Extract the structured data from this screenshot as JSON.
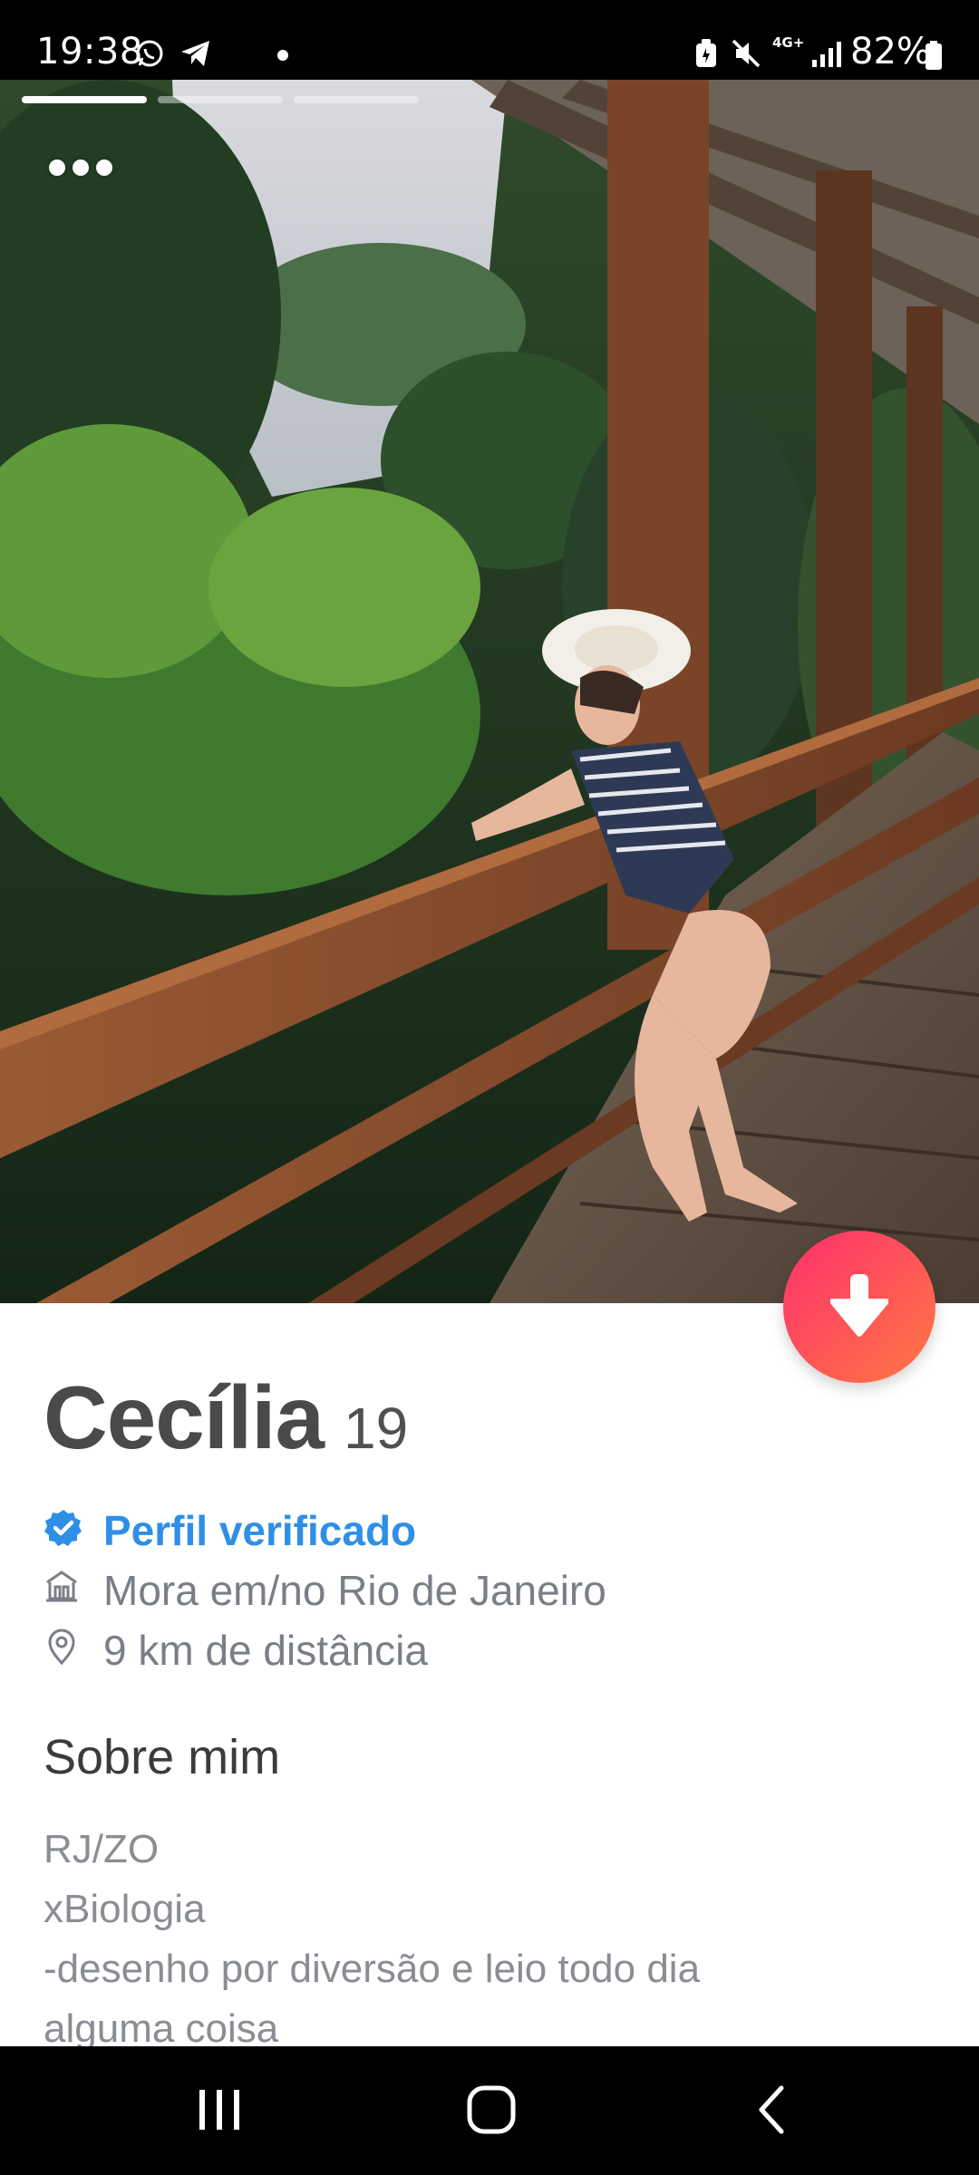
{
  "status_bar": {
    "time": "19:38",
    "network": "4G+",
    "battery": "82%",
    "icons": [
      "whatsapp-icon",
      "telegram-icon",
      "notification-dot",
      "battery-saver-icon",
      "mute-icon",
      "signal-icon",
      "battery-icon"
    ]
  },
  "photo": {
    "description_icon": "profile-photo",
    "photo_count": 3,
    "active_photo_index": 0
  },
  "actions": {
    "fab_icon": "arrow-down-icon",
    "more_icon": "more-dots-icon"
  },
  "profile": {
    "name": "Cecília",
    "age": "19",
    "verified_label": "Perfil verificado",
    "lives_in": "Mora em/no Rio de Janeiro",
    "distance": "9 km de distância"
  },
  "about": {
    "heading": "Sobre mim",
    "lines": [
      "RJ/ZO",
      "xBiologia",
      "-desenho por diversão e leio todo dia",
      "alguma coisa"
    ]
  },
  "colors": {
    "accent_gradient_start": "#fd2f6e",
    "accent_gradient_end": "#ff7a45",
    "verified_blue": "#2f8fe6"
  }
}
